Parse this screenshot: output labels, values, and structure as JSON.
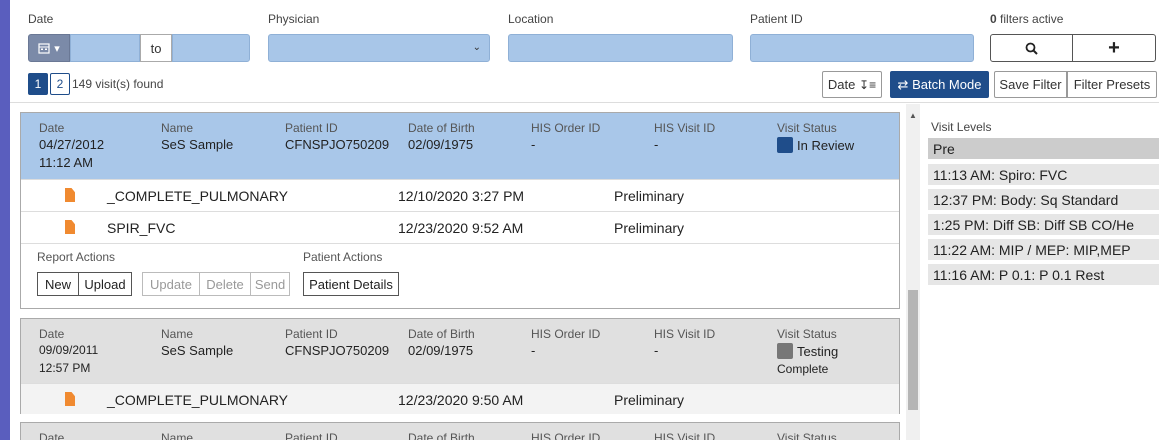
{
  "filters": {
    "date_label": "Date",
    "to_label": "to",
    "physician_label": "Physician",
    "location_label": "Location",
    "patient_id_label": "Patient ID",
    "active_count": "0",
    "active_label": "filters active"
  },
  "pagination": {
    "pages": [
      "1",
      "2"
    ],
    "active_page": "1",
    "found_text": "149 visit(s) found"
  },
  "toolbar": {
    "sort_label": "Date",
    "batch_label": "Batch Mode",
    "save_filter_label": "Save Filter",
    "presets_label": "Filter Presets"
  },
  "columns": {
    "date": "Date",
    "name": "Name",
    "patient_id": "Patient ID",
    "dob": "Date of Birth",
    "his_order": "HIS Order ID",
    "his_visit": "HIS Visit ID",
    "status": "Visit Status"
  },
  "visits": [
    {
      "date": "04/27/2012",
      "time": "11:12 AM",
      "name": "SeS Sample",
      "patient_id": "CFNSPJO750209",
      "dob": "02/09/1975",
      "his_order": "-",
      "his_visit": "-",
      "status": "In Review",
      "reports": [
        {
          "name": "_COMPLETE_PULMONARY",
          "datetime": "12/10/2020 3:27 PM",
          "state": "Preliminary"
        },
        {
          "name": "SPIR_FVC",
          "datetime": "12/23/2020 9:52 AM",
          "state": "Preliminary"
        }
      ]
    },
    {
      "date": "09/09/2011",
      "time": "12:57 PM",
      "name": "SeS Sample",
      "patient_id": "CFNSPJO750209",
      "dob": "02/09/1975",
      "his_order": "-",
      "his_visit": "-",
      "status_line1": "Testing",
      "status_line2": "Complete",
      "reports": [
        {
          "name": "_COMPLETE_PULMONARY",
          "datetime": "12/23/2020 9:50 AM",
          "state": "Preliminary"
        }
      ]
    }
  ],
  "report_actions": {
    "label": "Report Actions",
    "new": "New",
    "upload": "Upload",
    "update": "Update",
    "delete": "Delete",
    "send": "Send"
  },
  "patient_actions": {
    "label": "Patient Actions",
    "details": "Patient Details"
  },
  "visit_levels": {
    "title": "Visit Levels",
    "pre": "Pre",
    "items": [
      "11:13 AM: Spiro: FVC",
      "12:37 PM: Body: Sq Standard",
      "1:25 PM: Diff SB: Diff SB CO/He",
      "11:22 AM: MIP / MEP: MIP,MEP",
      "11:16 AM: P 0.1: P 0.1 Rest"
    ]
  },
  "colors": {
    "primary": "#1f4d8a",
    "field": "#a8c6e8",
    "selected_row": "#a9c7e9",
    "doc_icon": "#f08a30"
  }
}
